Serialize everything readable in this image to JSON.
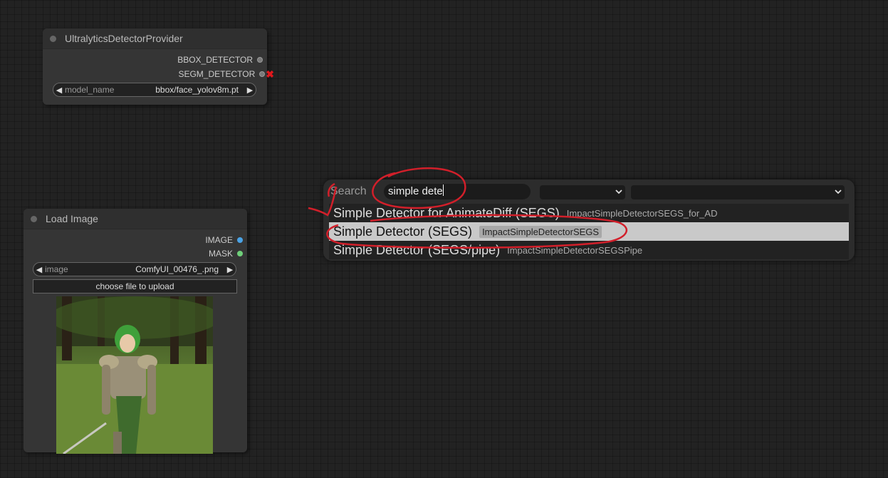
{
  "nodes": {
    "detector": {
      "title": "UltralyticsDetectorProvider",
      "outputs": [
        "BBOX_DETECTOR",
        "SEGM_DETECTOR"
      ],
      "widget": {
        "label": "model_name",
        "value": "bbox/face_yolov8m.pt"
      }
    },
    "load_image": {
      "title": "Load Image",
      "outputs": [
        "IMAGE",
        "MASK"
      ],
      "widget": {
        "label": "image",
        "value": "ComfyUI_00476_.png"
      },
      "upload_label": "choose file to upload"
    }
  },
  "search": {
    "label": "Search",
    "query": "simple dete",
    "results": [
      {
        "title": "Simple Detector for AnimateDiff (SEGS)",
        "id": "ImpactSimpleDetectorSEGS_for_AD",
        "selected": false
      },
      {
        "title": "Simple Detector (SEGS)",
        "id": "ImpactSimpleDetectorSEGS",
        "selected": true
      },
      {
        "title": "Simple Detector (SEGS/pipe)",
        "id": "ImpactSimpleDetectorSEGSPipe",
        "selected": false
      }
    ]
  },
  "colors": {
    "image_socket": "#4aa3e6",
    "mask_socket": "#6fcf7a",
    "disconnected_x": "#e0181d",
    "annotation_red": "#d21f2a"
  },
  "icons": {
    "left_arrow": "◀",
    "right_arrow": "▶",
    "disconnected": "✖"
  }
}
